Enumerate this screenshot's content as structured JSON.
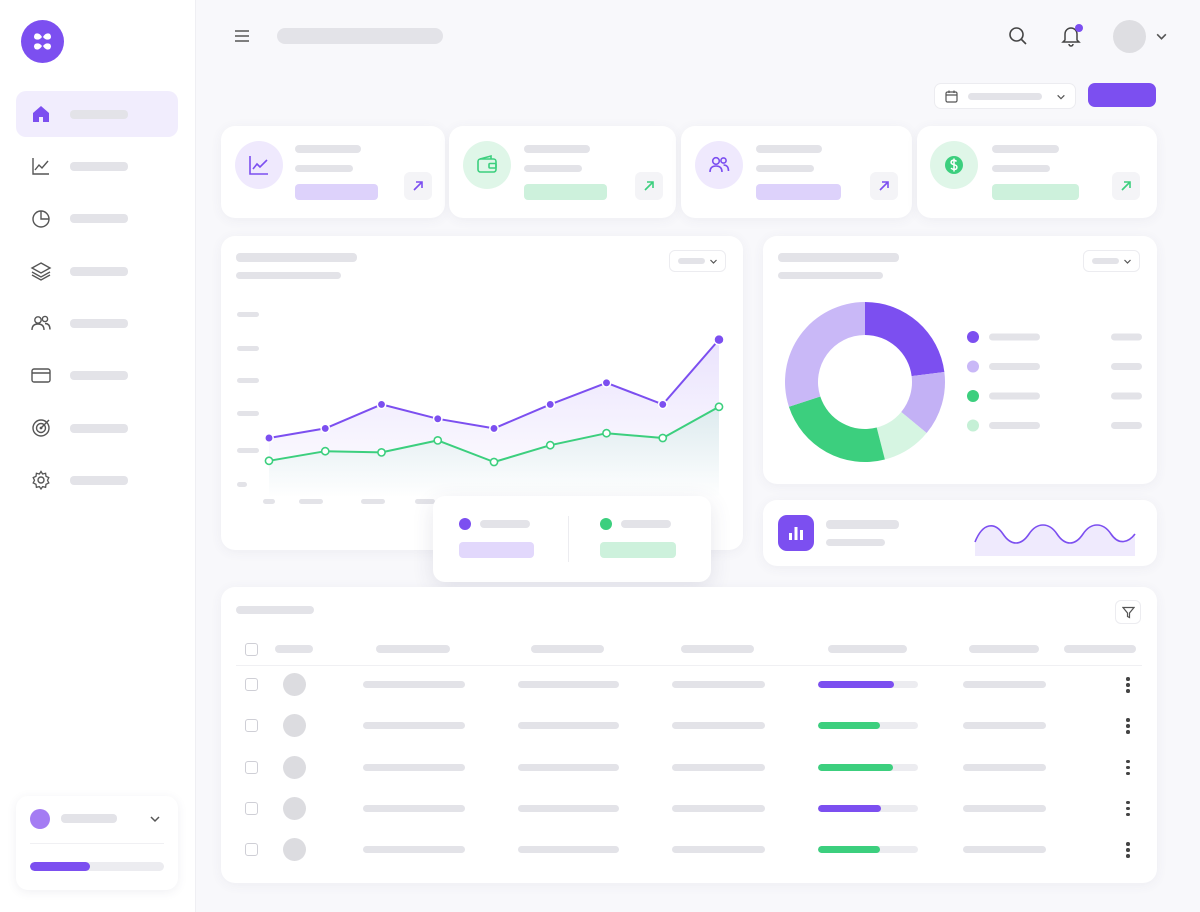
{
  "colors": {
    "accent": "#7c4ff0",
    "accent_light": "#c9b8f7",
    "green": "#3ccf7e",
    "green_light": "#c5f0d6",
    "placeholder": "#e3e3e8"
  },
  "sidebar": {
    "logo_icon": "logo-icon",
    "items": [
      {
        "icon": "home-icon",
        "active": true
      },
      {
        "icon": "line-chart-icon",
        "active": false
      },
      {
        "icon": "pie-chart-icon",
        "active": false
      },
      {
        "icon": "layers-icon",
        "active": false
      },
      {
        "icon": "users-icon",
        "active": false
      },
      {
        "icon": "credit-card-icon",
        "active": false
      },
      {
        "icon": "target-icon",
        "active": false
      },
      {
        "icon": "gear-icon",
        "active": false
      }
    ],
    "profile_progress": 0.45
  },
  "header": {
    "icons": [
      "menu-icon",
      "search-icon",
      "bell-icon",
      "chevron-down-icon"
    ],
    "notification_dot": true
  },
  "stat_cards": [
    {
      "icon": "line-chart-icon",
      "tone": "purple"
    },
    {
      "icon": "wallet-icon",
      "tone": "green"
    },
    {
      "icon": "users-icon",
      "tone": "purple"
    },
    {
      "icon": "dollar-coin-icon",
      "tone": "green"
    }
  ],
  "chart_data": [
    {
      "type": "line",
      "x": [
        1,
        2,
        3,
        4,
        5,
        6,
        7,
        8,
        9
      ],
      "series": [
        {
          "color": "#7c4ff0",
          "values": [
            50,
            58,
            78,
            66,
            58,
            78,
            96,
            78,
            132
          ]
        },
        {
          "color": "#3ccf7e",
          "values": [
            31,
            39,
            38,
            48,
            30,
            44,
            54,
            50,
            76
          ]
        }
      ],
      "ylim": [
        0,
        160
      ],
      "area_fill": true,
      "grid": false
    },
    {
      "type": "pie",
      "donut": true,
      "values": [
        23,
        13,
        10,
        24,
        30
      ],
      "colors": [
        "#7c4ff0",
        "#c3b1f5",
        "#d6f5e2",
        "#3ccf7e",
        "#c9b8f7"
      ],
      "legend_colors": [
        "#7c4ff0",
        "#c9b8f7",
        "#3ccf7e",
        "#c5f0d6"
      ],
      "legend_position": "right"
    }
  ],
  "table": {
    "filter_icon": "filter-icon",
    "column_count": 7,
    "rows": [
      {
        "progress": 0.76,
        "color": "#7c4ff0"
      },
      {
        "progress": 0.62,
        "color": "#3ccf7e"
      },
      {
        "progress": 0.75,
        "color": "#3ccf7e"
      },
      {
        "progress": 0.63,
        "color": "#7c4ff0"
      },
      {
        "progress": 0.62,
        "color": "#3ccf7e"
      }
    ]
  }
}
